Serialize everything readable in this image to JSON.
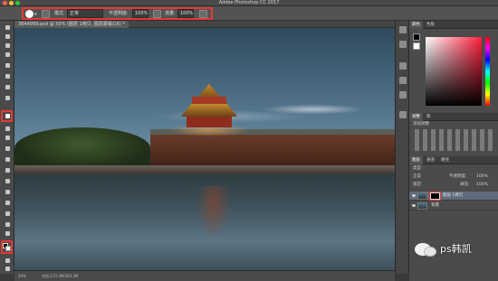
{
  "app": {
    "title": "Adobe Photoshop CC 2017"
  },
  "options": {
    "mode_label": "模式:",
    "mode_value": "正常",
    "opacity_label": "不透明度:",
    "opacity_value": "100%",
    "flow_label": "流量:",
    "flow_value": "100%"
  },
  "document": {
    "tab_label": "38A4999.psd @ 50% (图层 1拷贝, 图层蒙版/16) *",
    "zoom": "50%",
    "doc_size": "文档:173.3M/303.2M"
  },
  "panels": {
    "color_tabs": [
      "颜色",
      "色板"
    ],
    "adjust_tabs": [
      "调整",
      "库"
    ],
    "adjust_hint": "添加调整",
    "layers_tabs": [
      "图层",
      "通道",
      "路径"
    ],
    "kind_label": "类型",
    "blend_mode": "正常",
    "opacity_label": "不透明度:",
    "opacity_value": "100%",
    "lock_label": "锁定:",
    "fill_label": "填充:",
    "fill_value": "100%",
    "layers": [
      {
        "name": "图层 1拷贝",
        "selected": true,
        "has_mask": true
      },
      {
        "name": "背景",
        "selected": false,
        "has_mask": false
      }
    ]
  },
  "watermark": {
    "text": "ps韩凯"
  },
  "colors": {
    "highlight": "#e53935",
    "foreground": "#000000",
    "background": "#ffffff"
  },
  "icons": {
    "toolbar": [
      "move-icon",
      "marquee-icon",
      "lasso-icon",
      "quick-select-icon",
      "crop-icon",
      "eyedropper-icon",
      "healing-icon",
      "brush-icon",
      "stamp-icon",
      "history-brush-icon",
      "eraser-icon",
      "gradient-icon",
      "blur-icon",
      "dodge-icon",
      "pen-icon",
      "type-icon",
      "path-select-icon",
      "shape-icon",
      "hand-icon",
      "zoom-icon"
    ]
  }
}
